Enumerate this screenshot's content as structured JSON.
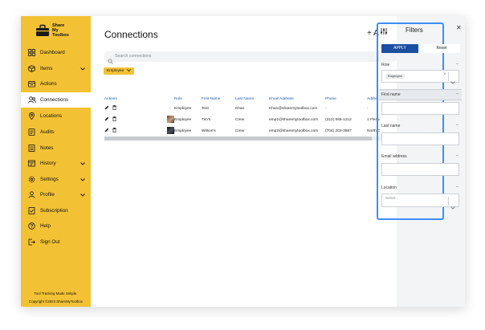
{
  "brand": {
    "name_line1": "Share",
    "name_line2": "My",
    "name_line3": "Toolbox",
    "color": "#F3C234",
    "tagline": "Tool Tracking Made Simple.",
    "copyright": "Copyright ©2023 ShareMyToolbox"
  },
  "sidebar": {
    "items": [
      {
        "label": "Dashboard",
        "icon": "dashboard-icon"
      },
      {
        "label": "Items",
        "icon": "box-icon",
        "chevron": true
      },
      {
        "label": "Actions",
        "icon": "actions-icon"
      },
      {
        "label": "Connections",
        "icon": "connections-icon",
        "active": true
      },
      {
        "label": "Locations",
        "icon": "location-pin-icon"
      },
      {
        "label": "Audits",
        "icon": "audit-icon"
      },
      {
        "label": "Notes",
        "icon": "notes-icon"
      },
      {
        "label": "History",
        "icon": "history-icon",
        "chevron": true
      },
      {
        "label": "Settings",
        "icon": "gear-icon",
        "chevron": true
      },
      {
        "label": "Profile",
        "icon": "profile-icon",
        "chevron": true
      },
      {
        "label": "Subscription",
        "icon": "subscription-icon"
      },
      {
        "label": "Help",
        "icon": "help-icon"
      },
      {
        "label": "Sign Out",
        "icon": "sign-out-icon"
      }
    ]
  },
  "main": {
    "title": "Connections",
    "add_label": "+ A",
    "search_placeholder": "Search connections",
    "active_filter_chip": "Employee",
    "table": {
      "headers": [
        "Actions",
        "",
        "Role",
        "First Name",
        "Last Name",
        "Email Address",
        "Phone",
        "Addre"
      ],
      "rows": [
        {
          "thumb": "-",
          "role": "Employee",
          "first": "Test",
          "last": "Khan",
          "email": "Khan@sharemytoolbox.com",
          "phone": "-",
          "address": "-"
        },
        {
          "thumb": "image",
          "role": "Employee",
          "first": "Tim's",
          "last": "Crew",
          "email": "emp1@sharemytoolbox.com",
          "phone": "(212) 555-1212",
          "address": "1 Flemi"
        },
        {
          "thumb": "image",
          "role": "Employee",
          "first": "Wilson's",
          "last": "Crew",
          "email": "emp2@sharemytoolbox.com",
          "phone": "(704) 202-3687",
          "address": "North C"
        }
      ]
    }
  },
  "filters": {
    "title": "Filters",
    "apply_label": "APPLY",
    "reset_label": "Reset",
    "role_label": "Role",
    "role_value": "Employee",
    "first_name_label": "First name",
    "last_name_label": "Last name",
    "email_label": "Email address",
    "location_label": "Location",
    "location_placeholder": "Select...",
    "collapse_symbol": "–",
    "close_symbol": "✕",
    "clear_symbol": "×",
    "highlight_color": "#3d8ff4",
    "apply_color": "#1c4fa1"
  }
}
